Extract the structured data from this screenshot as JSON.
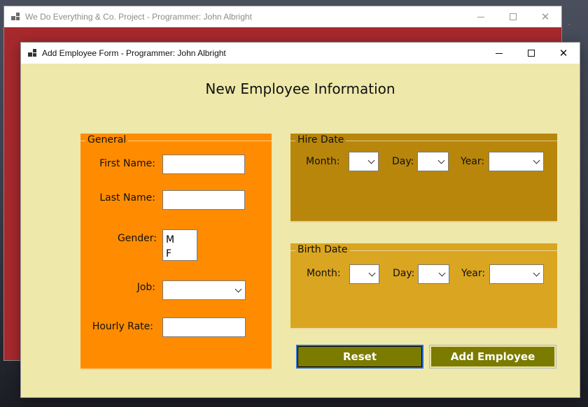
{
  "back_window": {
    "title": "We Do Everything & Co. Project - Programmer: John Albright",
    "icon": "app-window-icon",
    "controls": {
      "minimize": "minimize",
      "maximize": "maximize",
      "close": "✕"
    }
  },
  "front_window": {
    "title": "Add Employee Form - Programmer: John Albright",
    "icon": "app-window-icon",
    "controls": {
      "minimize": "minimize",
      "maximize": "maximize",
      "close": "✕"
    }
  },
  "form": {
    "heading": "New Employee Information",
    "general": {
      "legend": "General",
      "first_name_label": "First Name:",
      "first_name_value": "",
      "last_name_label": "Last Name:",
      "last_name_value": "",
      "gender_label": "Gender:",
      "gender_options": [
        "M",
        "F"
      ],
      "job_label": "Job:",
      "job_value": "",
      "hourly_rate_label": "Hourly Rate:",
      "hourly_rate_value": ""
    },
    "hire_date": {
      "legend": "Hire Date",
      "month_label": "Month:",
      "day_label": "Day:",
      "year_label": "Year:"
    },
    "birth_date": {
      "legend": "Birth Date",
      "month_label": "Month:",
      "day_label": "Day:",
      "year_label": "Year:"
    },
    "buttons": {
      "reset": "Reset",
      "add_employee": "Add Employee"
    }
  },
  "colors": {
    "form_background": "#eee8aa",
    "general_group": "#ff8c00",
    "hire_group": "#b8860b",
    "birth_group": "#daa520",
    "button": "#7b7b00",
    "back_window": "#a6292d"
  }
}
